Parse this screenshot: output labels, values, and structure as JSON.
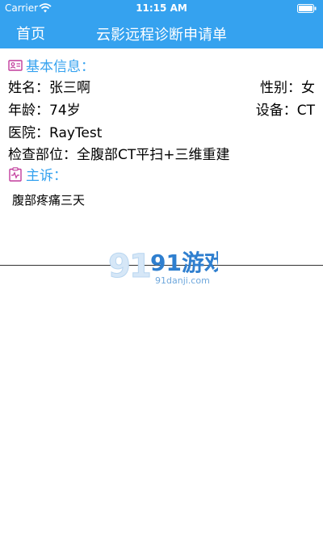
{
  "status_bar": {
    "carrier": "Carrier",
    "time": "11:15 AM"
  },
  "nav": {
    "back_label": "首页",
    "title": "云影远程诊断申请单"
  },
  "basic_info": {
    "heading": "基本信息：",
    "name": "姓名：张三啊",
    "gender": "性别：女",
    "age": "年龄：74岁",
    "device": "设备：CT",
    "hospital": "医院：RayTest",
    "exam_part": "检查部位：全腹部CT平扫+三维重建"
  },
  "complaint": {
    "heading": "主诉：",
    "text": "腹部疼痛三天"
  },
  "watermark": {
    "brand": "91游戏",
    "domain": "91danji.com"
  },
  "colors": {
    "accent": "#35a2ef",
    "section_icon": "#c23c9c"
  },
  "icons": {
    "info": "id-card-icon",
    "complaint": "clipboard-pulse-icon"
  }
}
